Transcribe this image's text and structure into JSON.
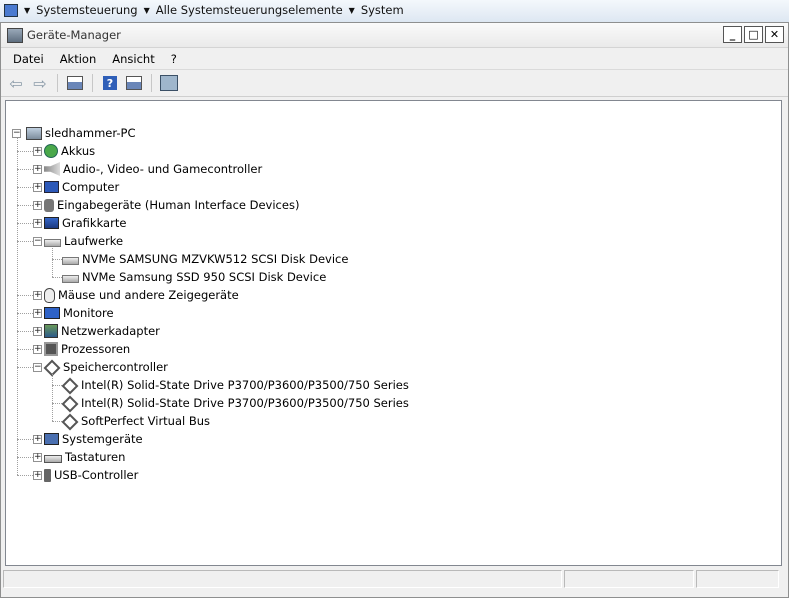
{
  "background": {
    "breadcrumb": [
      "Systemsteuerung",
      "Alle Systemsteuerungselemente",
      "System"
    ]
  },
  "window": {
    "title": "Geräte-Manager",
    "buttons": {
      "minimize": "_",
      "maximize": "□",
      "close": "✕"
    }
  },
  "menu": [
    "Datei",
    "Aktion",
    "Ansicht",
    "?"
  ],
  "tree": {
    "root": "sledhammer-PC",
    "items": [
      {
        "label": "Akkus",
        "icon": "battery-icon",
        "expanded": false
      },
      {
        "label": "Audio-, Video- und Gamecontroller",
        "icon": "audio-icon",
        "expanded": false
      },
      {
        "label": "Computer",
        "icon": "computer-icon",
        "expanded": false
      },
      {
        "label": "Eingabegeräte (Human Interface Devices)",
        "icon": "hid-icon",
        "expanded": false
      },
      {
        "label": "Grafikkarte",
        "icon": "graphics-card-icon",
        "expanded": false
      },
      {
        "label": "Laufwerke",
        "icon": "drive-icon",
        "expanded": true,
        "children": [
          "NVMe SAMSUNG MZVKW512 SCSI Disk Device",
          "NVMe Samsung SSD 950 SCSI Disk Device"
        ]
      },
      {
        "label": "Mäuse und andere Zeigegeräte",
        "icon": "mouse-icon",
        "expanded": false
      },
      {
        "label": "Monitore",
        "icon": "monitor-icon",
        "expanded": false
      },
      {
        "label": "Netzwerkadapter",
        "icon": "network-icon",
        "expanded": false
      },
      {
        "label": "Prozessoren",
        "icon": "processor-icon",
        "expanded": false
      },
      {
        "label": "Speichercontroller",
        "icon": "storage-controller-icon",
        "expanded": true,
        "children": [
          "Intel(R) Solid-State Drive P3700/P3600/P3500/750 Series",
          "Intel(R) Solid-State Drive P3700/P3600/P3500/750 Series",
          "SoftPerfect Virtual Bus"
        ]
      },
      {
        "label": "Systemgeräte",
        "icon": "system-devices-icon",
        "expanded": false
      },
      {
        "label": "Tastaturen",
        "icon": "keyboard-icon",
        "expanded": false
      },
      {
        "label": "USB-Controller",
        "icon": "usb-icon",
        "expanded": false
      }
    ]
  }
}
